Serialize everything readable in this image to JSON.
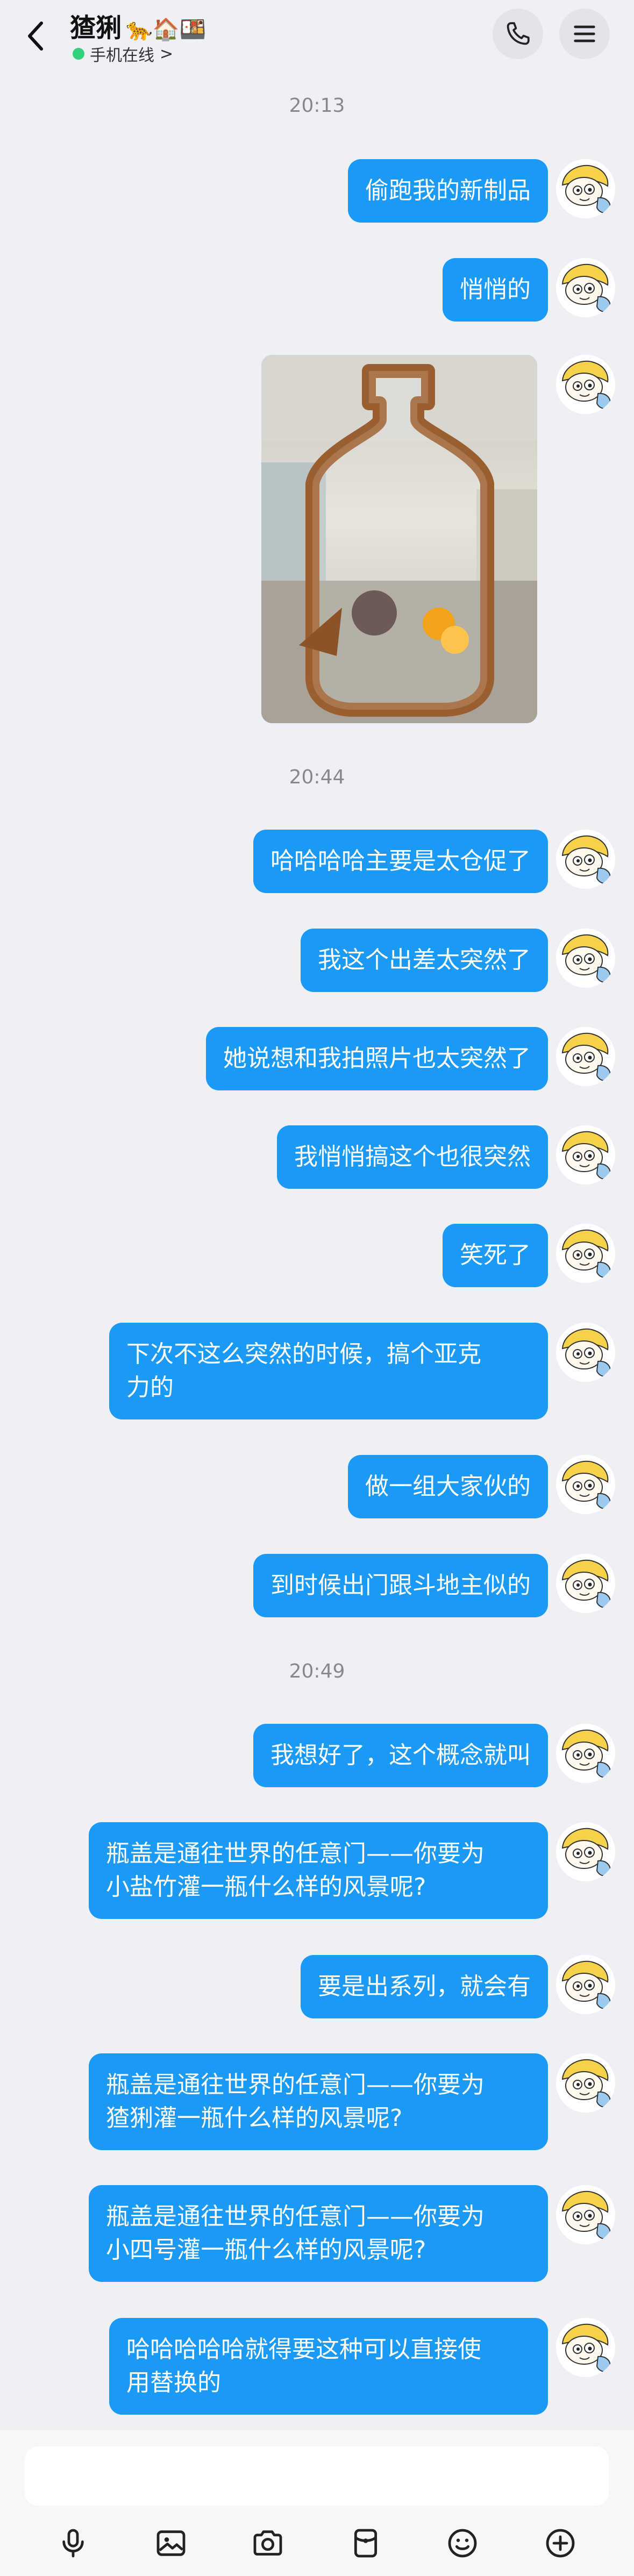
{
  "header": {
    "title": "猹猁",
    "title_emoji": "🐆🏠🍱",
    "status": "手机在线",
    "status_chevron": ">"
  },
  "messages": [
    {
      "type": "time",
      "text": "20:13"
    },
    {
      "type": "text",
      "text": "偷跑我的新制品"
    },
    {
      "type": "text",
      "text": "悄悄的"
    },
    {
      "type": "image",
      "alt": "bottle-shaped wooden frame photo"
    },
    {
      "type": "time",
      "text": "20:44"
    },
    {
      "type": "text",
      "text": "哈哈哈哈主要是太仓促了"
    },
    {
      "type": "text",
      "text": "我这个出差太突然了"
    },
    {
      "type": "text",
      "text": "她说想和我拍照片也太突然了"
    },
    {
      "type": "text",
      "text": "我悄悄搞这个也很突然"
    },
    {
      "type": "text",
      "text": "笑死了"
    },
    {
      "type": "text",
      "text": "下次不这么突然的时候，搞个亚克\n力的"
    },
    {
      "type": "text",
      "text": "做一组大家伙的"
    },
    {
      "type": "text",
      "text": "到时候出门跟斗地主似的"
    },
    {
      "type": "time",
      "text": "20:49"
    },
    {
      "type": "text",
      "text": "我想好了，这个概念就叫"
    },
    {
      "type": "text",
      "text": "瓶盖是通往世界的任意门——你要为\n小盐竹灌一瓶什么样的风景呢?"
    },
    {
      "type": "text",
      "text": "要是出系列，就会有"
    },
    {
      "type": "text",
      "text": "瓶盖是通往世界的任意门——你要为\n猹猁灌一瓶什么样的风景呢?"
    },
    {
      "type": "text",
      "text": "瓶盖是通往世界的任意门——你要为\n小四号灌一瓶什么样的风景呢?"
    },
    {
      "type": "text",
      "text": "哈哈哈哈哈就得要这种可以直接使\n用替换的"
    }
  ],
  "toolbar": {
    "icons": [
      "microphone-icon",
      "image-icon",
      "camera-icon",
      "red-packet-icon",
      "emoji-icon",
      "plus-icon"
    ]
  },
  "colors": {
    "bubble": "#1a99f5",
    "background": "#eef0f5",
    "online": "#33d17a"
  }
}
